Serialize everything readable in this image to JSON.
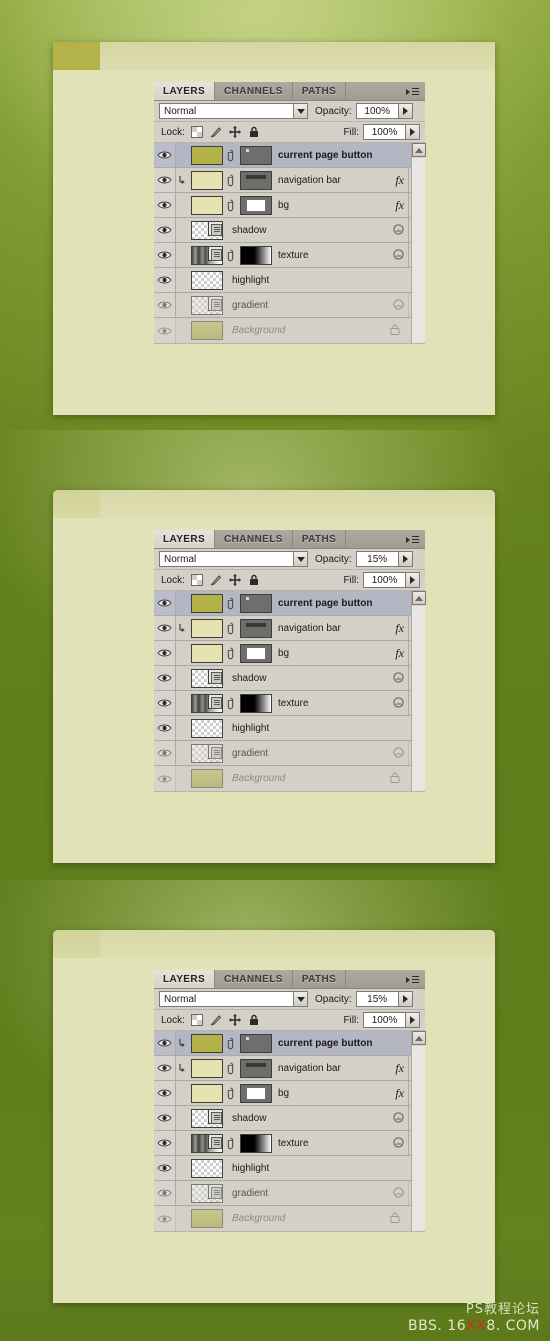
{
  "background": {
    "description": "green gradient backdrop",
    "color_top": "#8fa83c",
    "color_bottom": "#5d7a1b"
  },
  "panels": [
    {
      "id": "panel-1",
      "page": {
        "current_page_button_visible": true,
        "current_page_button_color": "#b4b34a",
        "nav_bar_color": "#d6d6a3",
        "body_color": "#e2e2b9"
      },
      "palette": {
        "tabs": [
          {
            "label": "LAYERS",
            "active": true
          },
          {
            "label": "CHANNELS",
            "active": false
          },
          {
            "label": "PATHS",
            "active": false
          }
        ],
        "menu_icon": "panel-menu-icon",
        "blend_mode": "Normal",
        "opacity_label": "Opacity:",
        "opacity_value": "100%",
        "lock_label": "Lock:",
        "lock_icons": [
          "lock-transparency-icon",
          "lock-image-icon",
          "lock-position-icon",
          "lock-all-icon"
        ],
        "fill_label": "Fill:",
        "fill_value": "100%",
        "layers": [
          {
            "name": "current page button",
            "selected": true,
            "clipped": false,
            "thumb": "btn-dark",
            "swatch": "solid-olive",
            "link": true,
            "fx": "",
            "arrow": false,
            "bold": true
          },
          {
            "name": "navigation bar",
            "selected": false,
            "clipped": true,
            "thumb": "nav-dark",
            "swatch": "solid-cream",
            "link": true,
            "fx": "fx",
            "arrow": true,
            "bold": false
          },
          {
            "name": "bg",
            "selected": false,
            "clipped": false,
            "thumb": "bg-white",
            "swatch": "solid-cream",
            "link": true,
            "fx": "fx",
            "arrow": true,
            "bold": false
          },
          {
            "name": "shadow",
            "selected": false,
            "clipped": false,
            "thumb": "checker-mask",
            "swatch": "",
            "link": false,
            "fx": "mask",
            "arrow": true,
            "bold": false
          },
          {
            "name": "texture",
            "selected": false,
            "clipped": false,
            "thumb": "blackgrad",
            "swatch": "stripes-mask",
            "link": true,
            "fx": "mask",
            "arrow": true,
            "bold": false
          },
          {
            "name": "highlight",
            "selected": false,
            "clipped": false,
            "thumb": "checker",
            "swatch": "",
            "link": false,
            "fx": "",
            "arrow": false,
            "bold": false
          },
          {
            "name": "gradient",
            "selected": false,
            "clipped": false,
            "thumb": "checker-mask",
            "swatch": "",
            "link": false,
            "fx": "mask",
            "arrow": true,
            "bold": false,
            "faded": true
          },
          {
            "name": "Background",
            "selected": false,
            "clipped": false,
            "thumb": "bg-olive",
            "swatch": "",
            "link": false,
            "fx": "lock",
            "arrow": false,
            "bold": false,
            "faded2": true,
            "italic": true
          }
        ]
      }
    },
    {
      "id": "panel-2",
      "page": {
        "current_page_button_visible": false,
        "current_page_button_color": "rgba(180,179,74,0.15)",
        "nav_bar_color": "#d8d8a8",
        "body_color": "#e2e2b9"
      },
      "palette": {
        "tabs": [
          {
            "label": "LAYERS",
            "active": true
          },
          {
            "label": "CHANNELS",
            "active": false
          },
          {
            "label": "PATHS",
            "active": false
          }
        ],
        "menu_icon": "panel-menu-icon",
        "blend_mode": "Normal",
        "opacity_label": "Opacity:",
        "opacity_value": "15%",
        "lock_label": "Lock:",
        "lock_icons": [
          "lock-transparency-icon",
          "lock-image-icon",
          "lock-position-icon",
          "lock-all-icon"
        ],
        "fill_label": "Fill:",
        "fill_value": "100%",
        "layers": [
          {
            "name": "current page button",
            "selected": true,
            "clipped": false,
            "thumb": "btn-dark",
            "swatch": "solid-olive",
            "link": true,
            "fx": "",
            "arrow": false,
            "bold": true
          },
          {
            "name": "navigation bar",
            "selected": false,
            "clipped": true,
            "thumb": "nav-dark",
            "swatch": "solid-cream",
            "link": true,
            "fx": "fx",
            "arrow": true,
            "bold": false
          },
          {
            "name": "bg",
            "selected": false,
            "clipped": false,
            "thumb": "bg-white",
            "swatch": "solid-cream",
            "link": true,
            "fx": "fx",
            "arrow": true,
            "bold": false
          },
          {
            "name": "shadow",
            "selected": false,
            "clipped": false,
            "thumb": "checker-mask",
            "swatch": "",
            "link": false,
            "fx": "mask",
            "arrow": true,
            "bold": false
          },
          {
            "name": "texture",
            "selected": false,
            "clipped": false,
            "thumb": "blackgrad",
            "swatch": "stripes-mask",
            "link": true,
            "fx": "mask",
            "arrow": true,
            "bold": false
          },
          {
            "name": "highlight",
            "selected": false,
            "clipped": false,
            "thumb": "checker",
            "swatch": "",
            "link": false,
            "fx": "",
            "arrow": false,
            "bold": false
          },
          {
            "name": "gradient",
            "selected": false,
            "clipped": false,
            "thumb": "checker-mask",
            "swatch": "",
            "link": false,
            "fx": "mask",
            "arrow": true,
            "bold": false,
            "faded": true
          },
          {
            "name": "Background",
            "selected": false,
            "clipped": false,
            "thumb": "bg-olive",
            "swatch": "",
            "link": false,
            "fx": "lock",
            "arrow": false,
            "bold": false,
            "faded2": true,
            "italic": true
          }
        ]
      }
    },
    {
      "id": "panel-3",
      "page": {
        "current_page_button_visible": false,
        "current_page_button_color": "rgba(180,179,74,0.15)",
        "nav_bar_color": "#d8d8a8",
        "body_color": "#e2e2b9"
      },
      "palette": {
        "tabs": [
          {
            "label": "LAYERS",
            "active": true
          },
          {
            "label": "CHANNELS",
            "active": false
          },
          {
            "label": "PATHS",
            "active": false
          }
        ],
        "menu_icon": "panel-menu-icon",
        "blend_mode": "Normal",
        "opacity_label": "Opacity:",
        "opacity_value": "15%",
        "lock_label": "Lock:",
        "lock_icons": [
          "lock-transparency-icon",
          "lock-image-icon",
          "lock-position-icon",
          "lock-all-icon"
        ],
        "fill_label": "Fill:",
        "fill_value": "100%",
        "layers": [
          {
            "name": "current page button",
            "selected": true,
            "clipped": true,
            "thumb": "btn-dark",
            "swatch": "solid-olive",
            "link": true,
            "fx": "",
            "arrow": false,
            "bold": true
          },
          {
            "name": "navigation bar",
            "selected": false,
            "clipped": true,
            "thumb": "nav-dark",
            "swatch": "solid-cream",
            "link": true,
            "fx": "fx",
            "arrow": true,
            "bold": false
          },
          {
            "name": "bg",
            "selected": false,
            "clipped": false,
            "thumb": "bg-white",
            "swatch": "solid-cream",
            "link": true,
            "fx": "fx",
            "arrow": true,
            "bold": false
          },
          {
            "name": "shadow",
            "selected": false,
            "clipped": false,
            "thumb": "checker-mask",
            "swatch": "",
            "link": false,
            "fx": "mask",
            "arrow": true,
            "bold": false
          },
          {
            "name": "texture",
            "selected": false,
            "clipped": false,
            "thumb": "blackgrad",
            "swatch": "stripes-mask",
            "link": true,
            "fx": "mask",
            "arrow": true,
            "bold": false
          },
          {
            "name": "highlight",
            "selected": false,
            "clipped": false,
            "thumb": "checker",
            "swatch": "",
            "link": false,
            "fx": "",
            "arrow": false,
            "bold": false
          },
          {
            "name": "gradient",
            "selected": false,
            "clipped": false,
            "thumb": "checker-mask",
            "swatch": "",
            "link": false,
            "fx": "mask",
            "arrow": true,
            "bold": false,
            "faded": true
          },
          {
            "name": "Background",
            "selected": false,
            "clipped": false,
            "thumb": "bg-olive",
            "swatch": "",
            "link": false,
            "fx": "lock",
            "arrow": false,
            "bold": false,
            "faded2": true,
            "italic": true
          }
        ]
      }
    }
  ],
  "watermark": {
    "line1": "PS教程论坛",
    "line2_pre": "BBS. 16",
    "line2_red": "XX",
    "line2_post": "8. COM",
    "red_color": "#d03020"
  }
}
